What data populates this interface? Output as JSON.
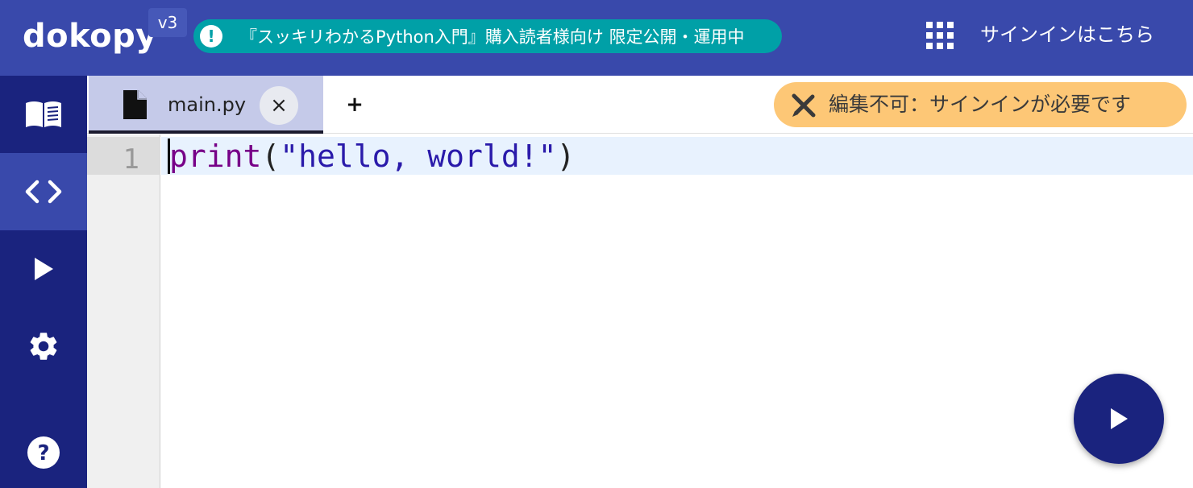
{
  "header": {
    "brand": "dokopy",
    "version": "v3",
    "notice_icon": "!",
    "notice_text": "『スッキリわかるPython入門』購入読者様向け 限定公開・運用中",
    "apps_icon": "apps-grid-icon",
    "signin_label": "サインインはこちら"
  },
  "sidebar": {
    "items": [
      {
        "name": "book",
        "icon": "book-icon",
        "active": false
      },
      {
        "name": "code",
        "icon": "code-icon",
        "active": true
      },
      {
        "name": "run",
        "icon": "play-icon",
        "active": false
      },
      {
        "name": "settings",
        "icon": "gear-icon",
        "active": false
      },
      {
        "name": "help",
        "icon": "help-icon",
        "active": false
      }
    ]
  },
  "tabs": {
    "items": [
      {
        "label": "main.py",
        "close": "×",
        "icon": "file-icon"
      }
    ],
    "add_label": "+"
  },
  "status": {
    "readonly_text": "編集不可：サインインが必要です",
    "icon": "edit-off-icon"
  },
  "editor": {
    "line_numbers": [
      "1"
    ],
    "code": {
      "fn": "print",
      "open": "(",
      "str": "\"hello, world!\"",
      "close": ")"
    }
  },
  "colors": {
    "topbar": "#3949ab",
    "sidebar": "#1a237e",
    "notice": "#00a0a7",
    "badge": "#fdc776",
    "active_tab": "#c5cae9"
  }
}
